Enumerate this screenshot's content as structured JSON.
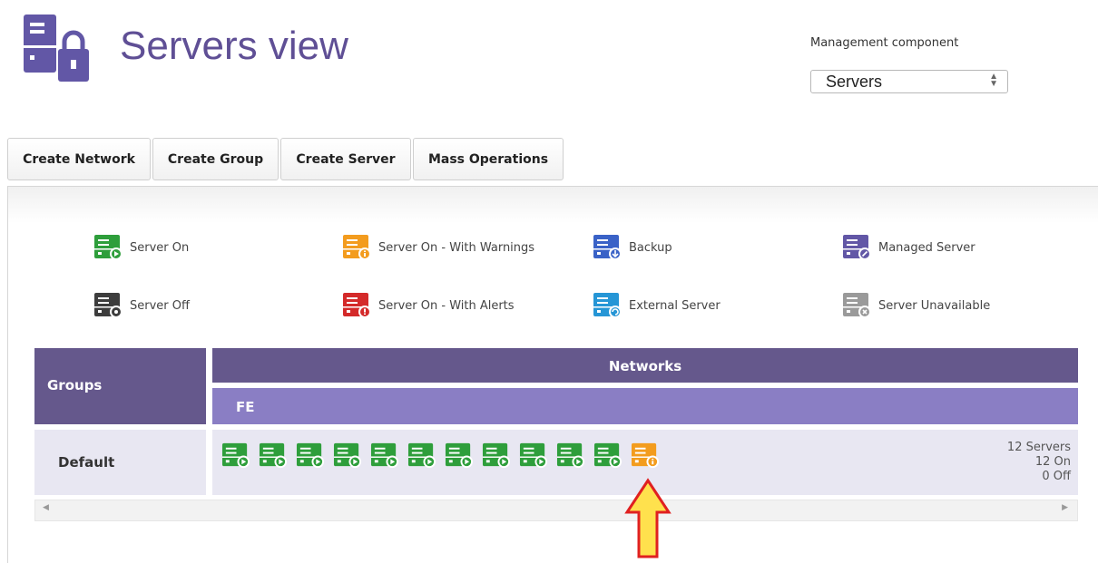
{
  "header": {
    "title": "Servers view",
    "icon": "server-lock-icon"
  },
  "management": {
    "label": "Management component",
    "selected": "Servers"
  },
  "toolbar": {
    "buttons": [
      {
        "label": "Create Network"
      },
      {
        "label": "Create Group"
      },
      {
        "label": "Create Server"
      },
      {
        "label": "Mass Operations"
      }
    ]
  },
  "legend": {
    "items": [
      {
        "label": "Server On",
        "color": "#2e9e3b",
        "badge": "play"
      },
      {
        "label": "Server On - With Warnings",
        "color": "#f39c1e",
        "badge": "info"
      },
      {
        "label": "Backup",
        "color": "#3a62c7",
        "badge": "download"
      },
      {
        "label": "Managed Server",
        "color": "#6257a6",
        "badge": "check"
      },
      {
        "label": "Server Off",
        "color": "#3d3d3d",
        "badge": "stop"
      },
      {
        "label": "Server On - With Alerts",
        "color": "#d42a2a",
        "badge": "alert"
      },
      {
        "label": "External Server",
        "color": "#2696d6",
        "badge": "refresh"
      },
      {
        "label": "Server Unavailable",
        "color": "#9a9a9a",
        "badge": "x"
      }
    ]
  },
  "grid": {
    "groups_header": "Groups",
    "networks_header": "Networks",
    "network_name": "FE",
    "rows": [
      {
        "group": "Default",
        "servers": [
          "on",
          "on",
          "on",
          "on",
          "on",
          "on",
          "on",
          "on",
          "on",
          "on",
          "on",
          "warning"
        ],
        "summary": {
          "total": "12 Servers",
          "on": "12 On",
          "off": "0 Off"
        }
      }
    ]
  },
  "colors": {
    "accent": "#65588c",
    "accent_light": "#8a7ec4",
    "row_bg": "#e8e7f2",
    "title": "#5f4f95",
    "arrow_fill": "#ffe14d",
    "arrow_stroke": "#e02020"
  }
}
